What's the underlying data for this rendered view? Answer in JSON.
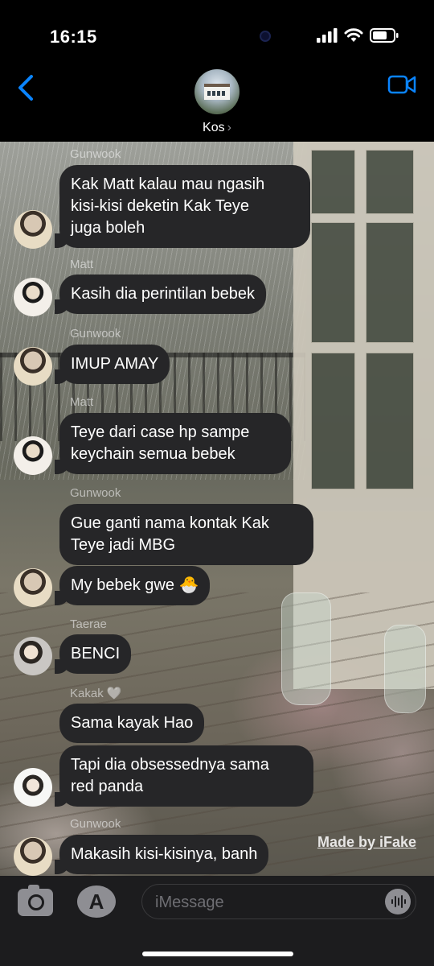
{
  "status": {
    "time": "16:15"
  },
  "header": {
    "contact_name": "Kos",
    "chevron": "›",
    "back_icon": "chevron-left-icon",
    "video_icon": "video-camera-icon"
  },
  "messages": [
    {
      "sender": "Gunwook",
      "avatar": "gunwook",
      "lines": [
        "Kak Matt kalau mau ngasih",
        "kisi-kisi deketin Kak Teye",
        "juga boleh"
      ]
    },
    {
      "sender": "Matt",
      "avatar": "matt",
      "lines": [
        "Kasih dia perintilan bebek"
      ]
    },
    {
      "sender": "Gunwook",
      "avatar": "gunwook",
      "lines": [
        "IMUP AMAY"
      ]
    },
    {
      "sender": "Matt",
      "avatar": "matt",
      "lines": [
        "Teye dari case hp sampe",
        "keychain semua bebek"
      ]
    },
    {
      "sender": "Gunwook",
      "avatar": null,
      "lines": [
        "Gue ganti nama kontak Kak",
        "Teye jadi MBG"
      ]
    },
    {
      "sender": null,
      "avatar": "gunwook",
      "lines": [
        "My bebek gwe 🐣"
      ]
    },
    {
      "sender": "Taerae",
      "avatar": "taerae",
      "lines": [
        "BENCI"
      ]
    },
    {
      "sender": "Kakak 🤍",
      "avatar": null,
      "lines": [
        "Sama kayak Hao"
      ]
    },
    {
      "sender": null,
      "avatar": "kakak",
      "lines": [
        "Tapi dia obsessednya sama",
        "red panda"
      ]
    },
    {
      "sender": "Gunwook",
      "avatar": "gunwook",
      "lines": [
        "Makasih kisi-kisinya, banh"
      ]
    }
  ],
  "watermark": "Made by iFake",
  "input": {
    "placeholder": "iMessage",
    "camera_icon": "camera-icon",
    "apps_icon": "app-store-icon",
    "audio_icon": "audio-waveform-icon"
  },
  "colors": {
    "accent": "#0a84ff",
    "bubble": "#262628",
    "bar": "#1c1c1e"
  }
}
